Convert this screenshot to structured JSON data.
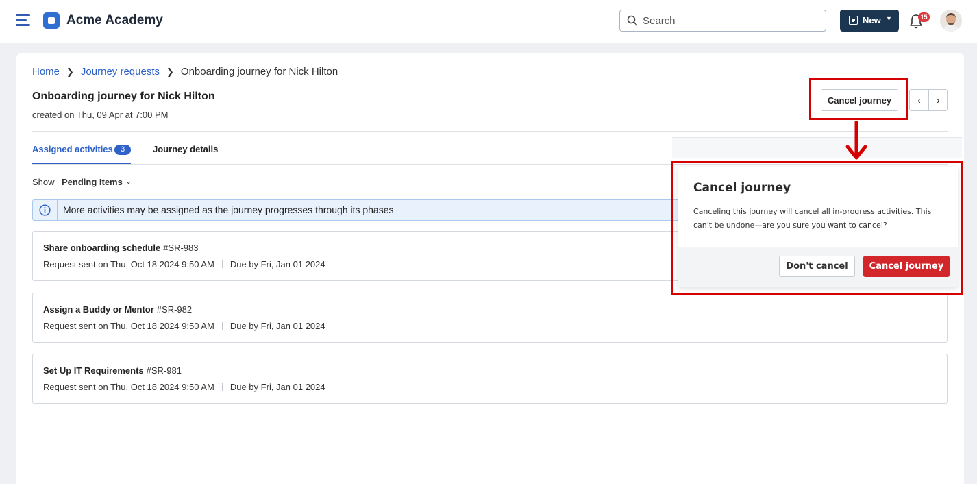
{
  "app": {
    "name": "Acme Academy"
  },
  "header": {
    "search_placeholder": "Search",
    "new_label": "New",
    "notification_count": "15"
  },
  "breadcrumb": {
    "home": "Home",
    "parent": "Journey requests",
    "current": "Onboarding journey for Nick Hilton"
  },
  "page": {
    "title": "Onboarding journey for Nick Hilton",
    "created": "created on Thu, 09 Apr at 7:00 PM",
    "cancel_label": "Cancel journey"
  },
  "tabs": [
    {
      "label": "Assigned activities",
      "count": "3",
      "active": true
    },
    {
      "label": "Journey details",
      "active": false
    }
  ],
  "filter": {
    "label": "Show",
    "value": "Pending Items"
  },
  "info_banner": "More activities may be assigned as the journey progresses through its phases",
  "activities": [
    {
      "title": "Share onboarding schedule",
      "id": "#SR-983",
      "sent_label": "Request sent on",
      "sent": "Thu, Oct 18 2024 9:50 AM",
      "due_label": "Due by",
      "due": "Fri, Jan 01 2024"
    },
    {
      "title": "Assign a Buddy or Mentor",
      "id": "#SR-982",
      "sent_label": "Request sent on",
      "sent": "Thu, Oct 18 2024 9:50 AM",
      "due_label": "Due by",
      "due": "Fri, Jan 01 2024"
    },
    {
      "title": "Set Up IT Requirements",
      "id": "#SR-981",
      "sent_label": "Request sent on",
      "sent": "Thu, Oct 18 2024 9:50 AM",
      "due_label": "Due by",
      "due": "Fri, Jan 01 2024"
    }
  ],
  "dialog": {
    "title": "Cancel journey",
    "message": "Canceling this journey will cancel all in-progress activities. This can't be undone—are you sure you want to cancel?",
    "dismiss_label": "Don't cancel",
    "confirm_label": "Cancel journey"
  },
  "colors": {
    "accent": "#2e62c9",
    "navy": "#1c3550",
    "danger": "#d3262b",
    "highlight": "#d50000"
  },
  "icons": {
    "menu": "hamburger-icon",
    "search": "search-icon",
    "bell": "bell-icon",
    "info": "info-icon",
    "prev": "chevron-left-icon",
    "next": "chevron-right-icon"
  }
}
